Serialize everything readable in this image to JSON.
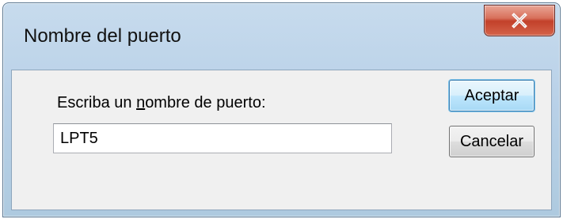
{
  "window": {
    "title": "Nombre del puerto",
    "close_icon": "close-icon",
    "close_icon_glyph": "X"
  },
  "form": {
    "prompt_label": "Escriba un nombre de puerto:",
    "prompt_accelerator": "n",
    "port_value": "LPT5"
  },
  "buttons": {
    "accept_label": "Aceptar",
    "cancel_label": "Cancelar"
  },
  "colors": {
    "title_glass": "#b9d1e8",
    "close_button": "#c2402a",
    "client_area": "#f0f0f0",
    "default_button_border": "#3c7fb1"
  }
}
